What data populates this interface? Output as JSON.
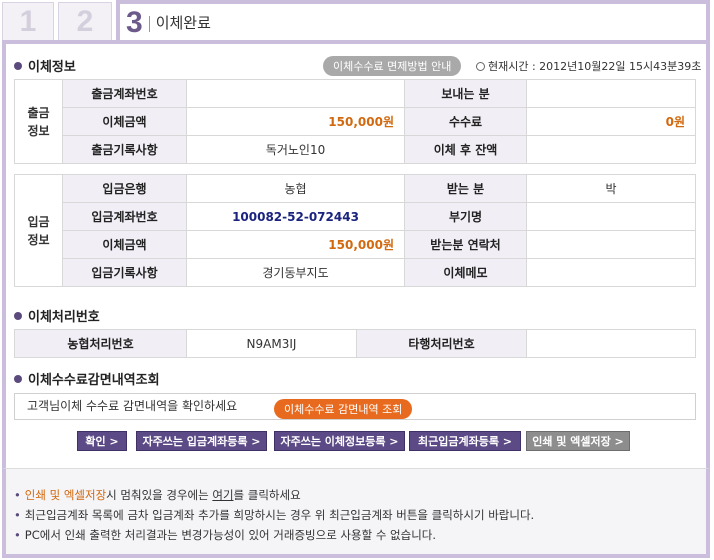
{
  "tabs": {
    "t1": "1",
    "t2": "2",
    "t3_num": "3",
    "t3_title": "이체완료"
  },
  "section1": {
    "title": "이체정보",
    "fee_pill": "이체수수료 면제방법 안내",
    "clock_label": "현재시간 : 2012년10월22일 15시43분39초"
  },
  "withdraw": {
    "group": "출금\n정보",
    "rows": [
      {
        "l1": "출금계좌번호",
        "v1": "",
        "l2": "보내는 분",
        "v2": ""
      },
      {
        "l1": "이체금액",
        "v1": "150,000원",
        "l2": "수수료",
        "v2": "0원"
      },
      {
        "l1": "출금기록사항",
        "v1": "독거노인10",
        "l2": "이체 후 잔액",
        "v2": ""
      }
    ]
  },
  "deposit": {
    "group": "입금\n정보",
    "rows": [
      {
        "l1": "입금은행",
        "v1": "농협",
        "l2": "받는 분",
        "v2": "박"
      },
      {
        "l1": "입금계좌번호",
        "v1": "100082-52-072443",
        "l2": "부기명",
        "v2": ""
      },
      {
        "l1": "이체금액",
        "v1": "150,000원",
        "l2": "받는분 연락처",
        "v2": ""
      },
      {
        "l1": "입금기록사항",
        "v1": "경기동부지도",
        "l2": "이체메모",
        "v2": ""
      }
    ]
  },
  "section2": {
    "title": "이체처리번호",
    "l1": "농협처리번호",
    "v1": "N9AM3IJ",
    "l2": "타행처리번호",
    "v2": ""
  },
  "section3": {
    "title": "이체수수료감면내역조회",
    "text": "고객님이체 수수료 감면내역을 확인하세요",
    "pill": "이체수수료 감면내역 조회"
  },
  "buttons": [
    "확인 >",
    "자주쓰는 입금계좌등록 >",
    "자주쓰는 이체정보등록 >",
    "최근입금계좌등록 >",
    "인쇄 및 엑셀저장 >"
  ],
  "notes": {
    "n1_hl": "인쇄 및 엑셀저장",
    "n1_mid": "시 멈춰있을 경우에는 ",
    "n1_link": "여기",
    "n1_end": "를 클릭하세요",
    "n2": "최근입금계좌 목록에 금차 입금계좌 추가를 희망하시는 경우 위 최근입금계좌 버튼을 클릭하시기 바랍니다.",
    "n3": "PC에서 인쇄 출력한 처리결과는 변경가능성이 있어 거래증빙으로 사용할 수 없습니다."
  },
  "colors": {
    "accent": "#5c4a86",
    "amount": "#d2690e",
    "account": "#1a237e",
    "border": "#cbbedd"
  }
}
